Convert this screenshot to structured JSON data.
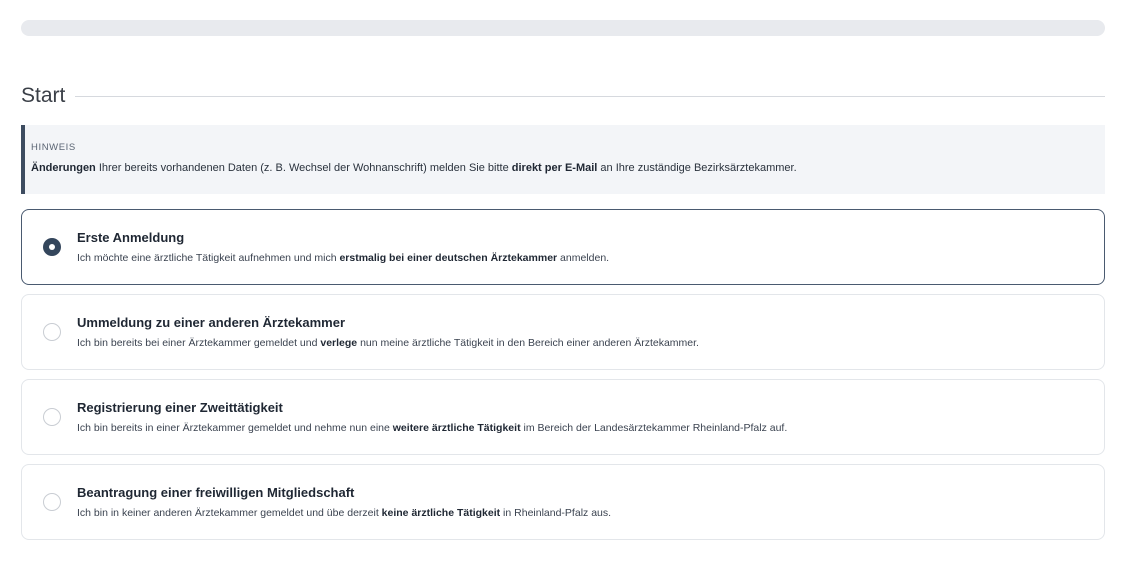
{
  "progress": {
    "value": 0
  },
  "section": {
    "title": "Start"
  },
  "notice": {
    "label": "HINWEIS",
    "parts": [
      {
        "text": "Änderungen",
        "bold": true
      },
      {
        "text": " Ihrer bereits vorhandenen Daten (z. B. Wechsel der Wohnanschrift) melden Sie bitte ",
        "bold": false
      },
      {
        "text": "direkt per E-Mail",
        "bold": true
      },
      {
        "text": " an Ihre zuständige Bezirksärztekammer.",
        "bold": false
      }
    ]
  },
  "options": [
    {
      "title": "Erste Anmeldung",
      "selected": true,
      "desc": [
        {
          "text": "Ich möchte eine ärztliche Tätigkeit aufnehmen und mich ",
          "bold": false
        },
        {
          "text": "erstmalig bei einer deutschen Ärztekammer",
          "bold": true
        },
        {
          "text": " anmelden.",
          "bold": false
        }
      ]
    },
    {
      "title": "Ummeldung zu einer anderen Ärztekammer",
      "selected": false,
      "desc": [
        {
          "text": "Ich bin bereits bei einer Ärztekammer gemeldet und ",
          "bold": false
        },
        {
          "text": "verlege",
          "bold": true
        },
        {
          "text": " nun meine ärztliche Tätigkeit in den Bereich einer anderen Ärztekammer.",
          "bold": false
        }
      ]
    },
    {
      "title": "Registrierung einer Zweittätigkeit",
      "selected": false,
      "desc": [
        {
          "text": "Ich bin bereits in einer Ärztekammer gemeldet und nehme nun eine ",
          "bold": false
        },
        {
          "text": "weitere ärztliche Tätigkeit",
          "bold": true
        },
        {
          "text": " im Bereich der Landesärztekammer Rheinland-Pfalz auf.",
          "bold": false
        }
      ]
    },
    {
      "title": "Beantragung einer freiwilligen Mitgliedschaft",
      "selected": false,
      "desc": [
        {
          "text": "Ich bin in keiner anderen Ärztekammer gemeldet und übe derzeit ",
          "bold": false
        },
        {
          "text": "keine ärztliche Tätigkeit",
          "bold": true
        },
        {
          "text": " in Rheinland-Pfalz aus.",
          "bold": false
        }
      ]
    }
  ],
  "colors": {
    "accent": "#34465c",
    "notice_bg": "#f3f5f8",
    "border": "#e3e6ea"
  }
}
